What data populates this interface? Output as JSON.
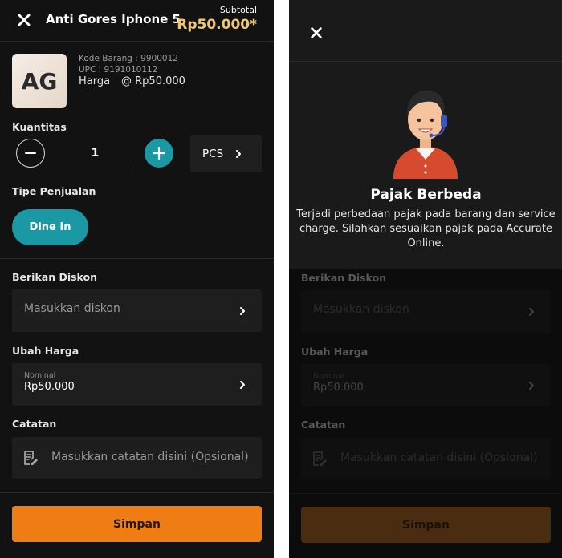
{
  "header": {
    "title": "Anti Gores Iphone 5",
    "subtotal_label": "Subtotal",
    "subtotal_value": "Rp50.000*"
  },
  "product": {
    "avatar_initials": "AG",
    "kode_barang": "Kode Barang : 9900012",
    "upc": "UPC : 9191010112",
    "harga_label": "Harga",
    "harga_value": "@ Rp50.000"
  },
  "quantity": {
    "label": "Kuantitas",
    "value": "1",
    "unit": "PCS"
  },
  "sales_type": {
    "label": "Tipe Penjualan",
    "selected": "Dine In"
  },
  "discount": {
    "label": "Berikan Diskon",
    "placeholder": "Masukkan diskon"
  },
  "price_change": {
    "label": "Ubah Harga",
    "nominal_label": "Nominal",
    "nominal_value": "Rp50.000"
  },
  "notes": {
    "label": "Catatan",
    "placeholder": "Masukkan catatan disini (Opsional)"
  },
  "save_label": "Simpan",
  "dialog": {
    "title": "Pajak Berbeda",
    "message": "Terjadi perbedaan pajak pada barang dan service charge. Silahkan sesuaikan pajak pada Accurate Online."
  },
  "colors": {
    "accent": "#1a98a4",
    "price": "#f1c86b",
    "save": "#ef7d14",
    "background": "#121212"
  },
  "icons": [
    "close-icon",
    "minus-icon",
    "plus-icon",
    "chevron-right-icon",
    "note-icon",
    "support-agent-illustration"
  ]
}
